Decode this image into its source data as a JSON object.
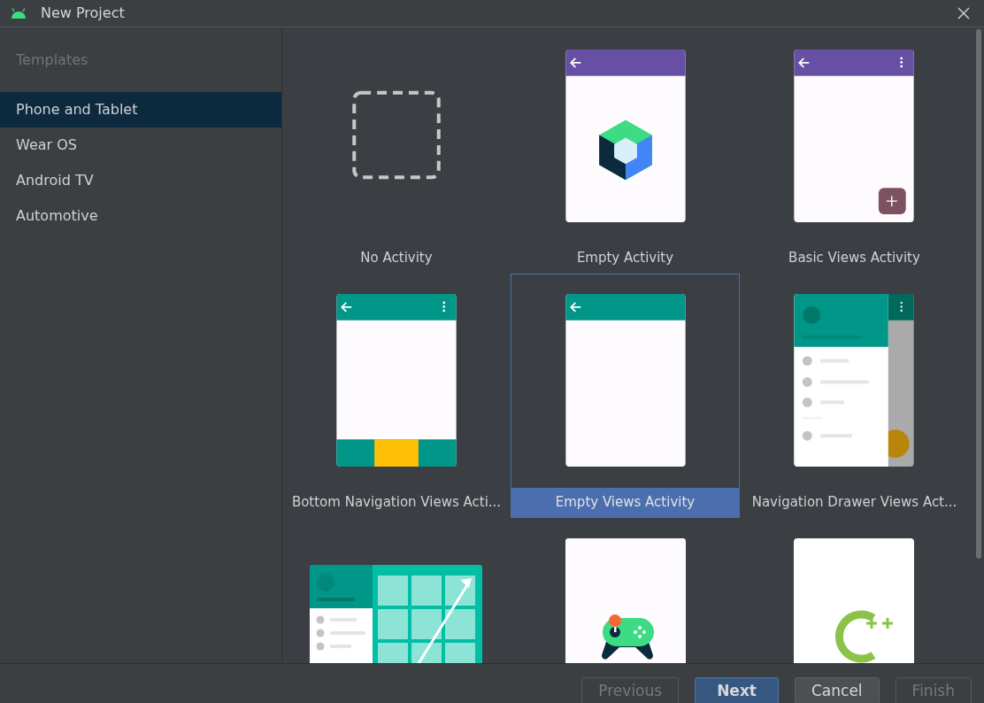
{
  "window": {
    "title": "New Project"
  },
  "sidebar": {
    "heading": "Templates",
    "items": [
      {
        "label": "Phone and Tablet",
        "selected": true
      },
      {
        "label": "Wear OS",
        "selected": false
      },
      {
        "label": "Android TV",
        "selected": false
      },
      {
        "label": "Automotive",
        "selected": false
      }
    ]
  },
  "templates": [
    {
      "kind": "none",
      "label": "No Activity",
      "selected": false
    },
    {
      "kind": "compose",
      "label": "Empty Activity",
      "selected": false
    },
    {
      "kind": "basic",
      "label": "Basic Views Activity",
      "selected": false
    },
    {
      "kind": "bottom_nav",
      "label": "Bottom Navigation Views Acti...",
      "selected": false
    },
    {
      "kind": "empty_views",
      "label": "Empty Views Activity",
      "selected": true
    },
    {
      "kind": "nav_drawer",
      "label": "Navigation Drawer Views Act...",
      "selected": false
    },
    {
      "kind": "responsive",
      "selected": false
    },
    {
      "kind": "game",
      "selected": false
    },
    {
      "kind": "cpp",
      "selected": false
    }
  ],
  "buttons": [
    {
      "label": "Previous",
      "kind": "secondary",
      "disabled": true
    },
    {
      "label": "Next",
      "kind": "primary",
      "disabled": false
    },
    {
      "label": "Cancel",
      "kind": "secondary",
      "disabled": false
    },
    {
      "label": "Finish",
      "kind": "secondary",
      "disabled": true
    }
  ]
}
